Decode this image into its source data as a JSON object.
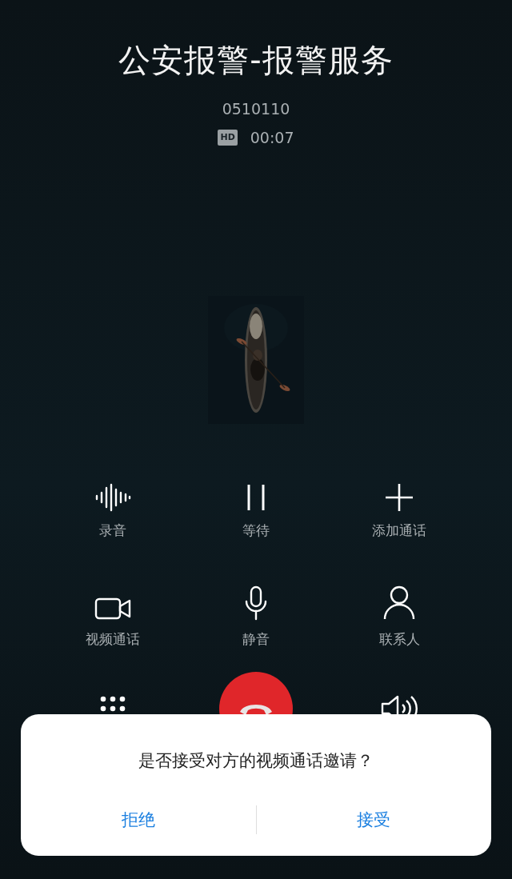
{
  "call": {
    "title": "公安报警-报警服务",
    "number": "0510110",
    "hd_badge": "HD",
    "duration": "00:07"
  },
  "controls": [
    {
      "kind": "record",
      "label": "录音"
    },
    {
      "kind": "hold",
      "label": "等待"
    },
    {
      "kind": "add",
      "label": "添加通话"
    },
    {
      "kind": "video",
      "label": "视频通话"
    },
    {
      "kind": "mute",
      "label": "静音"
    },
    {
      "kind": "contacts",
      "label": "联系人"
    }
  ],
  "bottom_controls": [
    {
      "kind": "keypad"
    },
    {
      "kind": "end"
    },
    {
      "kind": "speaker"
    }
  ],
  "dialog": {
    "message": "是否接受对方的视频通话邀请？",
    "buttons": [
      {
        "label": "拒绝"
      },
      {
        "label": "接受"
      }
    ]
  }
}
